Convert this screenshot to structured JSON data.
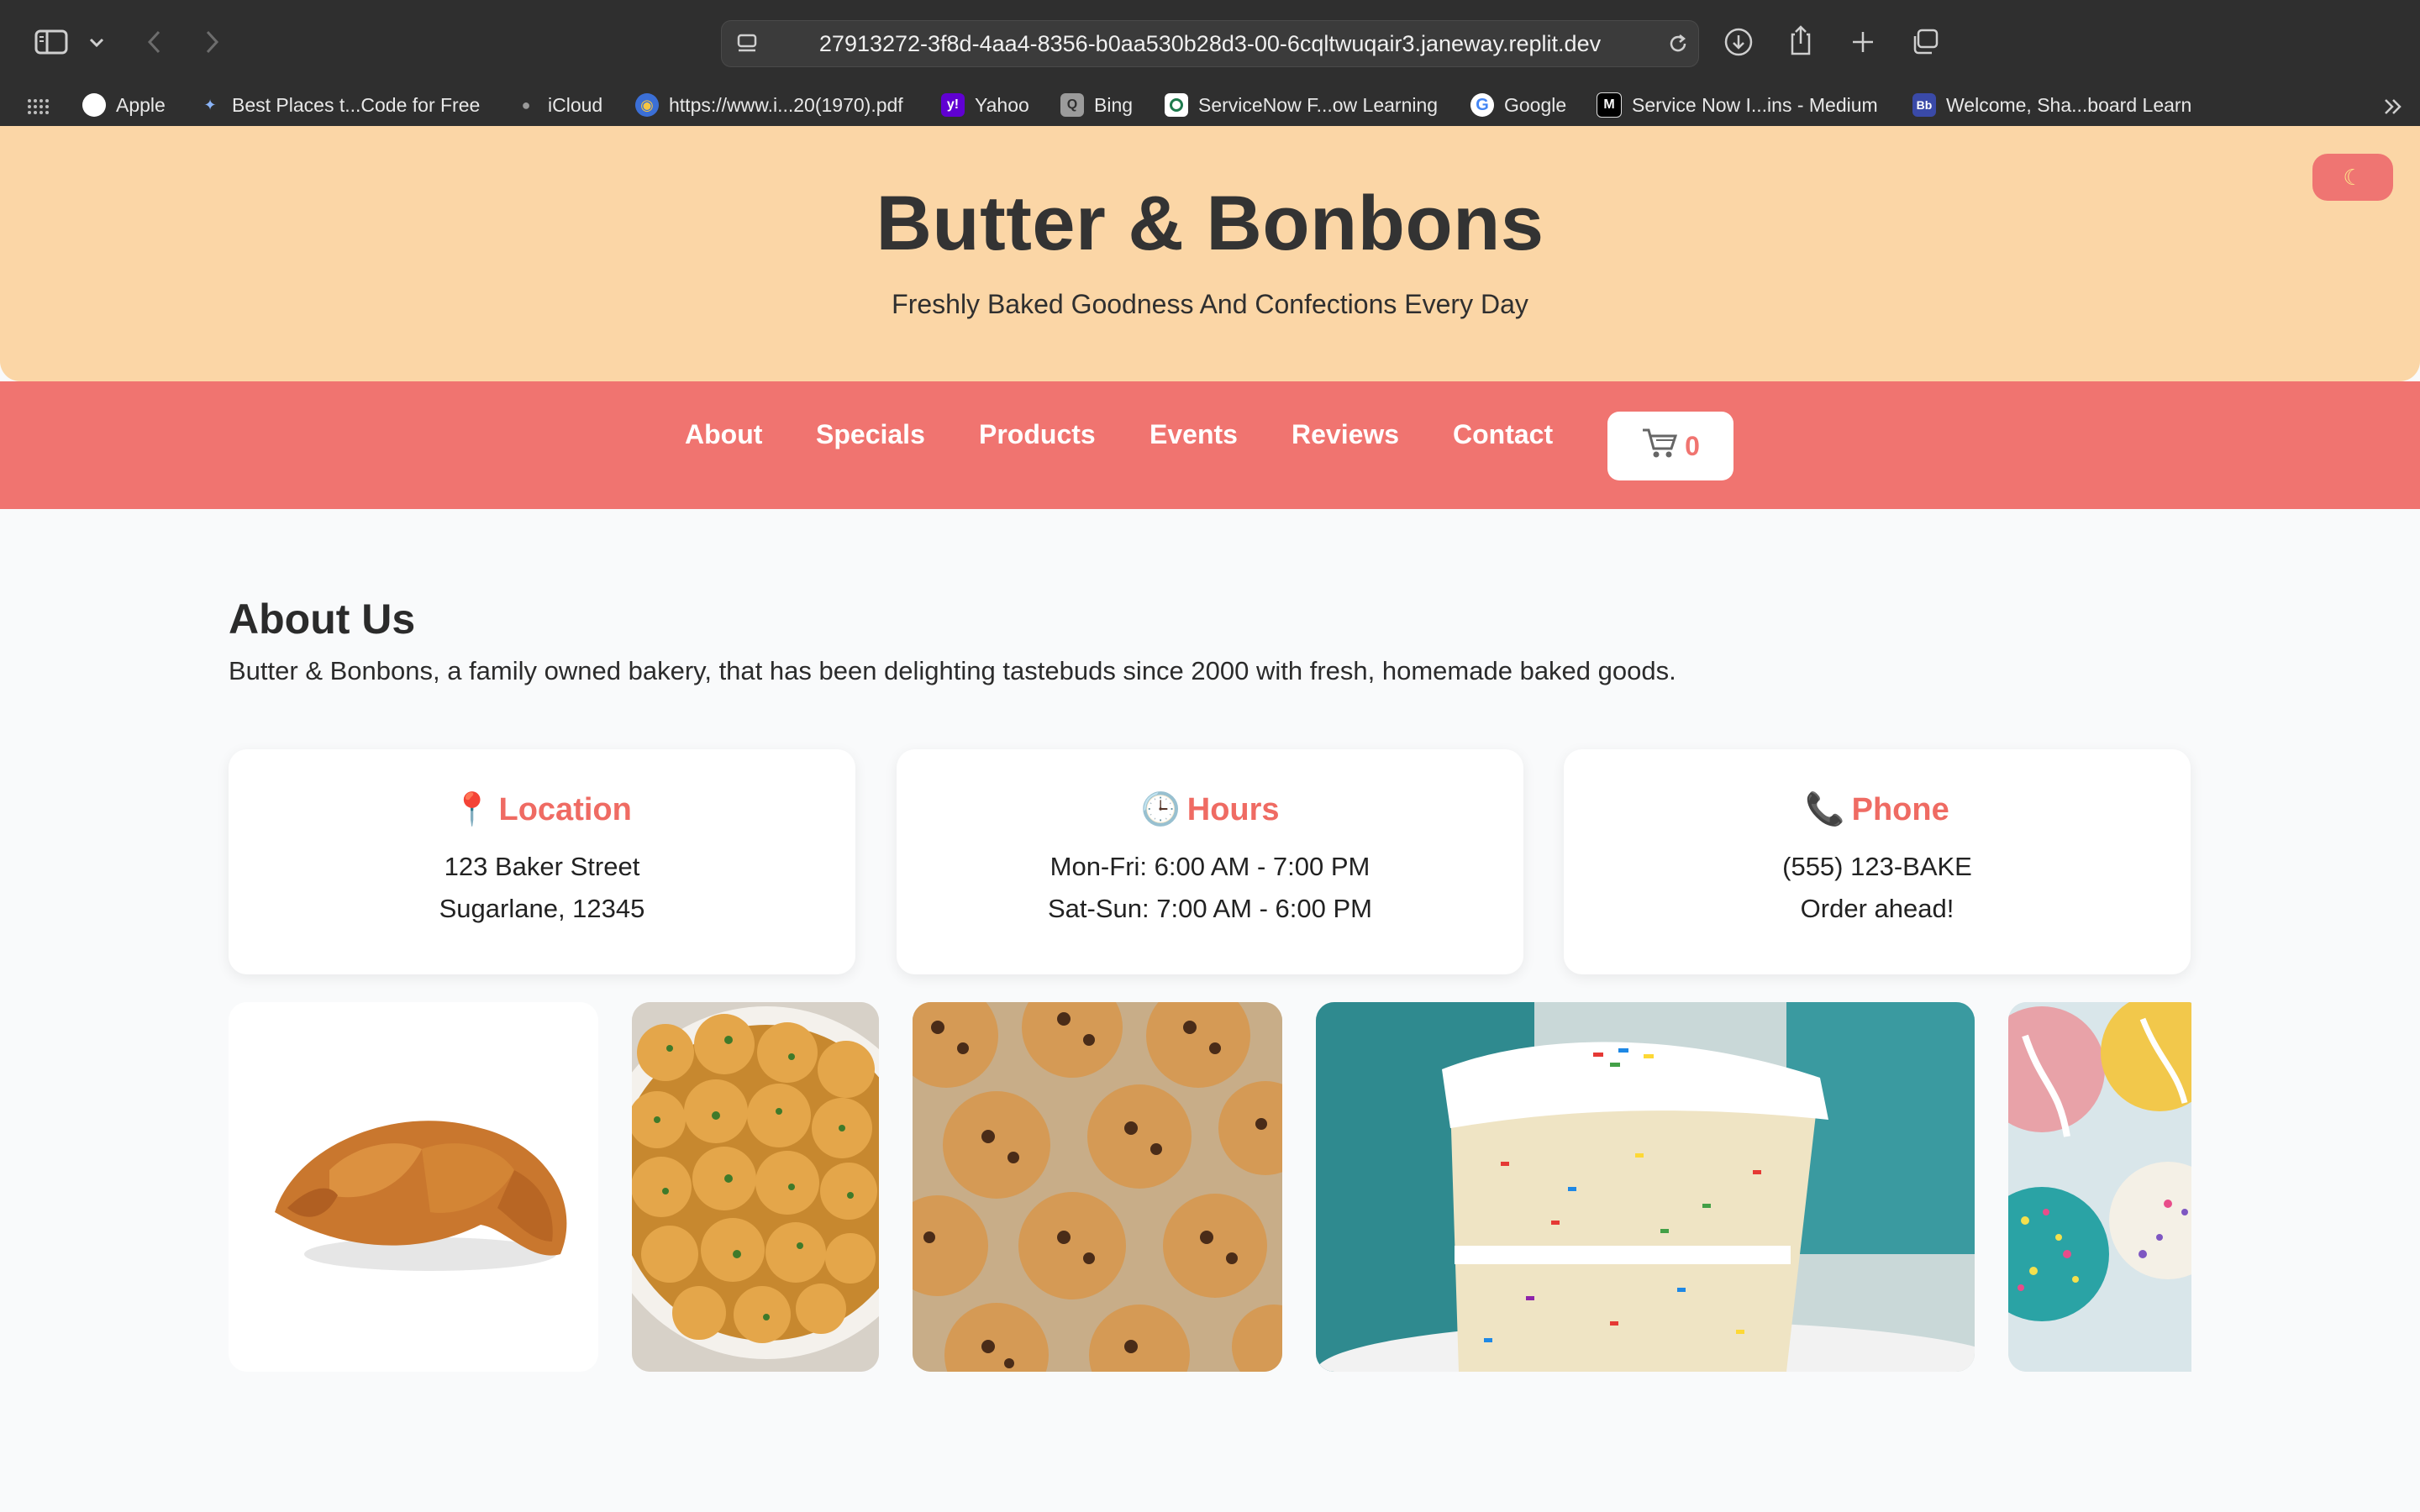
{
  "browser": {
    "url": "27913272-3f8d-4aa4-8356-b0aa530b28d3-00-6cqltwuqair3.janeway.replit.dev",
    "bookmarks": [
      {
        "label": "Apple",
        "icon": "apple-icon"
      },
      {
        "label": "Best Places t...Code for Free",
        "icon": "sparkle-icon"
      },
      {
        "label": "iCloud",
        "icon": "apple-icon"
      },
      {
        "label": "https://www.i...20(1970).pdf",
        "icon": "globe-icon"
      },
      {
        "label": "Yahoo",
        "icon": "yahoo-icon"
      },
      {
        "label": "Bing",
        "icon": "search-icon"
      },
      {
        "label": "ServiceNow F...ow Learning",
        "icon": "servicenow-icon"
      },
      {
        "label": "Google",
        "icon": "google-icon"
      },
      {
        "label": "Service Now I...ins - Medium",
        "icon": "medium-icon"
      },
      {
        "label": "Welcome, Sha...board Learn",
        "icon": "blackboard-icon"
      }
    ]
  },
  "header": {
    "title": "Butter & Bonbons",
    "tagline": "Freshly Baked Goodness And Confections Every Day",
    "theme_toggle_icon": "moon-icon"
  },
  "nav": {
    "links": [
      "About",
      "Specials",
      "Products",
      "Events",
      "Reviews",
      "Contact"
    ],
    "cart_count": "0",
    "cart_icon": "cart-icon"
  },
  "about": {
    "title": "About Us",
    "text": "Butter & Bonbons, a family owned bakery, that has been delighting tastebuds since 2000 with fresh, homemade baked goods."
  },
  "cards": [
    {
      "icon": "pin-icon",
      "title": "Location",
      "lines": [
        "123 Baker Street",
        "Sugarlane, 12345"
      ]
    },
    {
      "icon": "clock-icon",
      "title": "Hours",
      "lines": [
        "Mon-Fri: 6:00 AM - 7:00 PM",
        "Sat-Sun: 7:00 AM - 6:00 PM"
      ]
    },
    {
      "icon": "phone-icon",
      "title": "Phone",
      "lines": [
        "(555) 123-BAKE",
        "Order ahead!"
      ]
    }
  ],
  "gallery": [
    "croissant-image",
    "garlic-rolls-image",
    "cookies-image",
    "funfetti-cake-image",
    "cake-pops-image"
  ],
  "colors": {
    "header_bg": "#fbd6a6",
    "nav_bg": "#f07470",
    "accent": "#ef6b63",
    "page_bg": "#f9fafb"
  }
}
